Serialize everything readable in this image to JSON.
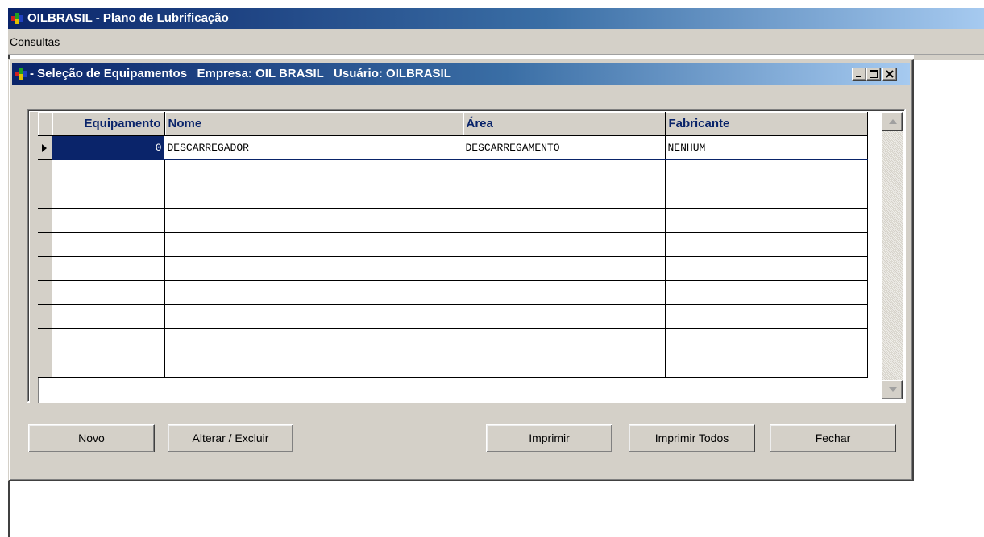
{
  "app": {
    "title": "OILBRASIL - Plano de Lubrificação",
    "icon": "app-logo-icon"
  },
  "menu": {
    "items": [
      {
        "label": "Consultas"
      }
    ]
  },
  "child_window": {
    "title": "- Seleção de Equipamentos   Empresa: OIL BRASIL   Usuário: OILBRASIL",
    "icon": "app-logo-icon",
    "controls": [
      "minimize-icon",
      "maximize-icon",
      "close-icon"
    ]
  },
  "grid": {
    "columns": [
      "Equipamento",
      "Nome",
      "Área",
      "Fabricante"
    ],
    "rows": [
      [
        "0",
        "DESCARREGADOR",
        "DESCARREGAMENTO",
        "NENHUM"
      ],
      [
        "",
        "",
        "",
        ""
      ],
      [
        "",
        "",
        "",
        ""
      ],
      [
        "",
        "",
        "",
        ""
      ],
      [
        "",
        "",
        "",
        ""
      ],
      [
        "",
        "",
        "",
        ""
      ],
      [
        "",
        "",
        "",
        ""
      ],
      [
        "",
        "",
        "",
        ""
      ],
      [
        "",
        "",
        "",
        ""
      ],
      [
        "",
        "",
        "",
        ""
      ]
    ],
    "current_row_marker": "row-pointer-icon"
  },
  "buttons": {
    "novo": "Novo",
    "alterar_excluir": "Alterar / Excluir",
    "imprimir": "Imprimir",
    "imprimir_todos": "Imprimir Todos",
    "fechar": "Fechar"
  },
  "colors": {
    "title_gradient_start": "#0a246a",
    "title_gradient_end": "#a6caf0",
    "face": "#d4d0c8",
    "header_text": "#0a246a",
    "selection": "#0a246a"
  }
}
